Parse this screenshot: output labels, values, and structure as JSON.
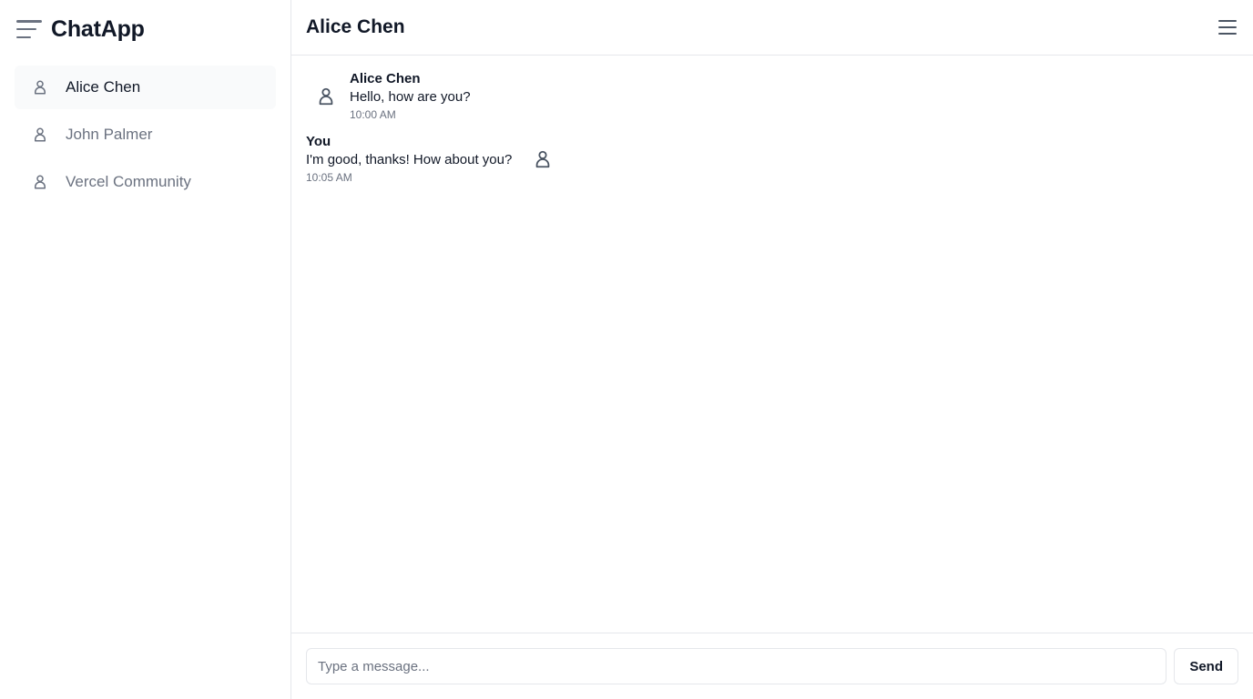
{
  "app": {
    "title": "ChatApp"
  },
  "sidebar": {
    "menu_icon": "hamburger-menu-icon",
    "contacts": [
      {
        "name": "Alice Chen",
        "icon": "user-icon",
        "active": true
      },
      {
        "name": "John Palmer",
        "icon": "user-icon",
        "active": false
      },
      {
        "name": "Vercel Community",
        "icon": "user-icon",
        "active": false
      }
    ]
  },
  "chat": {
    "title": "Alice Chen",
    "menu_icon": "menu-icon",
    "messages": [
      {
        "sender": "Alice Chen",
        "text": "Hello, how are you?",
        "time": "10:00 AM",
        "direction": "incoming"
      },
      {
        "sender": "You",
        "text": "I'm good, thanks! How about you?",
        "time": "10:05 AM",
        "direction": "outgoing"
      }
    ]
  },
  "composer": {
    "placeholder": "Type a message...",
    "value": "",
    "send_label": "Send"
  },
  "colors": {
    "text_primary": "#111827",
    "text_muted": "#6b7280",
    "border": "#e5e7eb",
    "active_bg": "#f9fafb"
  }
}
